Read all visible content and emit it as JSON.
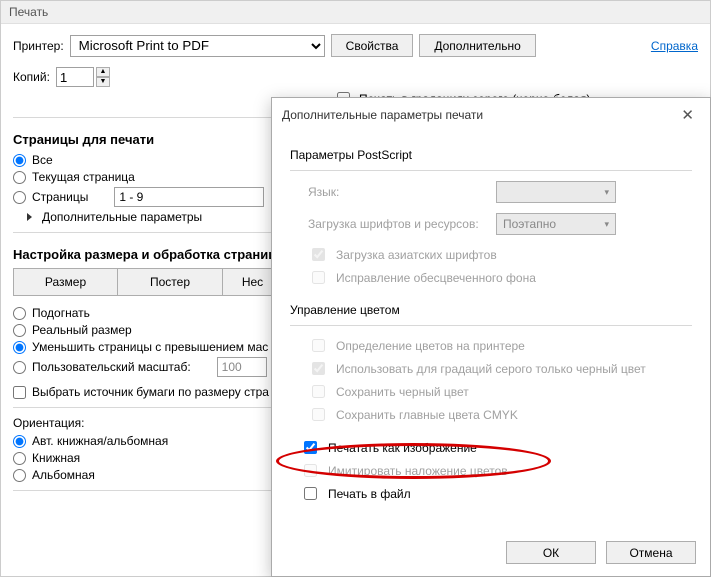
{
  "window_title": "Печать",
  "printer_label": "Принтер:",
  "printer_selected": "Microsoft Print to PDF",
  "properties_btn": "Свойства",
  "advanced_btn": "Дополнительно",
  "help_link": "Справка",
  "copies_label": "Копий:",
  "copies_value": "1",
  "grayscale_check": "Печать в градациях серого (черно-белая)",
  "pages_section": "Страницы для печати",
  "radio_all": "Все",
  "radio_current": "Текущая страница",
  "radio_pages": "Страницы",
  "pages_value": "1 - 9",
  "more_params": "Дополнительные параметры",
  "sizing_section": "Настройка размера и обработка страниц",
  "tab_size": "Размер",
  "tab_poster": "Постер",
  "tab_multi": "Нес",
  "fit": "Подогнать",
  "actual": "Реальный размер",
  "shrink": "Уменьшить страницы с превышением мас",
  "custom": "Пользовательский масштаб:",
  "custom_value": "100",
  "paper_source": "Выбрать источник бумаги по размеру стра",
  "orientation_label": "Ориентация:",
  "orient_auto": "Авт. книжная/альбомная",
  "orient_portrait": "Книжная",
  "orient_landscape": "Альбомная",
  "modal": {
    "title": "Дополнительные параметры печати",
    "ps_group": "Параметры PostScript",
    "lang_label": "Язык:",
    "fonts_label": "Загрузка шрифтов и ресурсов:",
    "fonts_value": "Поэтапно",
    "asian_fonts": "Загрузка азиатских шрифтов",
    "fix_bg": "Исправление обесцвеченного фона",
    "color_group": "Управление цветом",
    "detect_colors": "Определение цветов на принтере",
    "gray_black": "Использовать для градаций серого только черный цвет",
    "preserve_black": "Сохранить черный цвет",
    "preserve_cmyk": "Сохранить главные цвета CMYK",
    "print_as_image": "Печатать как изображение",
    "overlay": "Имитировать наложение цветов",
    "print_to_file": "Печать в файл",
    "ok": "ОК",
    "cancel": "Отмена"
  }
}
